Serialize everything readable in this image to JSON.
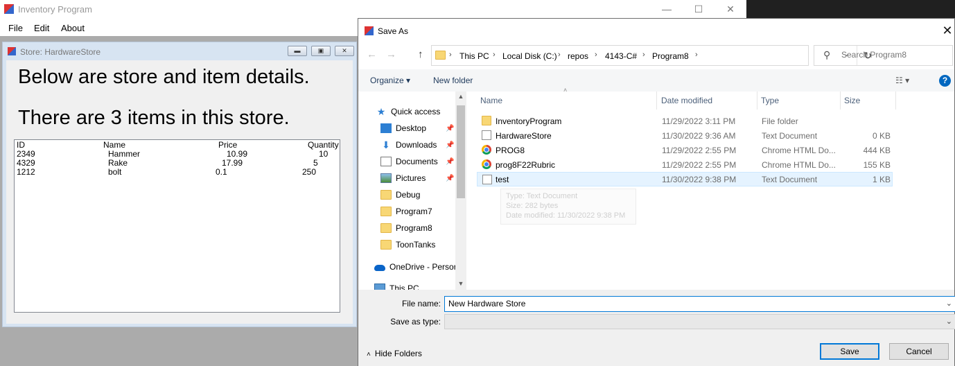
{
  "app": {
    "title": "Inventory Program",
    "menu": [
      "File",
      "Edit",
      "About"
    ],
    "controls": {
      "minimize": "—",
      "maximize": "☐",
      "close": "✕"
    }
  },
  "child": {
    "title": "Store: HardwareStore",
    "heading1": "Below are store and item details.",
    "heading2": "There are 3 items in this store.",
    "columns": [
      "ID",
      "Name",
      "Price",
      "Quantity"
    ],
    "rows": [
      [
        "2349",
        "Hammer",
        "10.99",
        "10"
      ],
      [
        "4329",
        "Rake",
        "17.99",
        "5"
      ],
      [
        "1212",
        "bolt",
        "0.1",
        "250"
      ]
    ]
  },
  "dialog": {
    "title": "Save As",
    "breadcrumb": [
      "This PC",
      "Local Disk (C:)",
      "repos",
      "4143-C#",
      "Program8"
    ],
    "search_placeholder": "Search Program8",
    "organize": "Organize ▾",
    "new_folder": "New folder",
    "help": "?",
    "nav_items": [
      {
        "label": "Quick access",
        "icon": "star-icon"
      },
      {
        "label": "Desktop",
        "icon": "desktop-icon"
      },
      {
        "label": "Downloads",
        "icon": "download-icon"
      },
      {
        "label": "Documents",
        "icon": "documents-icon"
      },
      {
        "label": "Pictures",
        "icon": "pictures-icon"
      },
      {
        "label": "Debug",
        "icon": "folder-icon"
      },
      {
        "label": "Program7",
        "icon": "folder-icon"
      },
      {
        "label": "Program8",
        "icon": "folder-icon"
      },
      {
        "label": "ToonTanks",
        "icon": "folder-icon"
      },
      {
        "label": "OneDrive - Persor",
        "icon": "onedrive-icon"
      },
      {
        "label": "This PC",
        "icon": "computer-icon"
      }
    ],
    "columns": [
      "Name",
      "Date modified",
      "Type",
      "Size"
    ],
    "files": [
      {
        "name": "InventoryProgram",
        "date": "11/29/2022 3:11 PM",
        "type": "File folder",
        "size": "",
        "icon": "folder-icon"
      },
      {
        "name": "HardwareStore",
        "date": "11/30/2022 9:36 AM",
        "type": "Text Document",
        "size": "0 KB",
        "icon": "text-file-icon"
      },
      {
        "name": "PROG8",
        "date": "11/29/2022 2:55 PM",
        "type": "Chrome HTML Do...",
        "size": "444 KB",
        "icon": "chrome-icon"
      },
      {
        "name": "prog8F22Rubric",
        "date": "11/29/2022 2:55 PM",
        "type": "Chrome HTML Do...",
        "size": "155 KB",
        "icon": "chrome-icon"
      },
      {
        "name": "test",
        "date": "11/30/2022 9:38 PM",
        "type": "Text Document",
        "size": "1 KB",
        "icon": "text-file-icon"
      }
    ],
    "tooltip": [
      "Type: Text Document",
      "Size: 282 bytes",
      "Date modified: 11/30/2022 9:38 PM"
    ],
    "file_name_label": "File name:",
    "file_name_value": "New Hardware Store",
    "save_as_type_label": "Save as type:",
    "save_as_type_value": "",
    "hide_folders": "Hide Folders",
    "save": "Save",
    "cancel": "Cancel"
  }
}
